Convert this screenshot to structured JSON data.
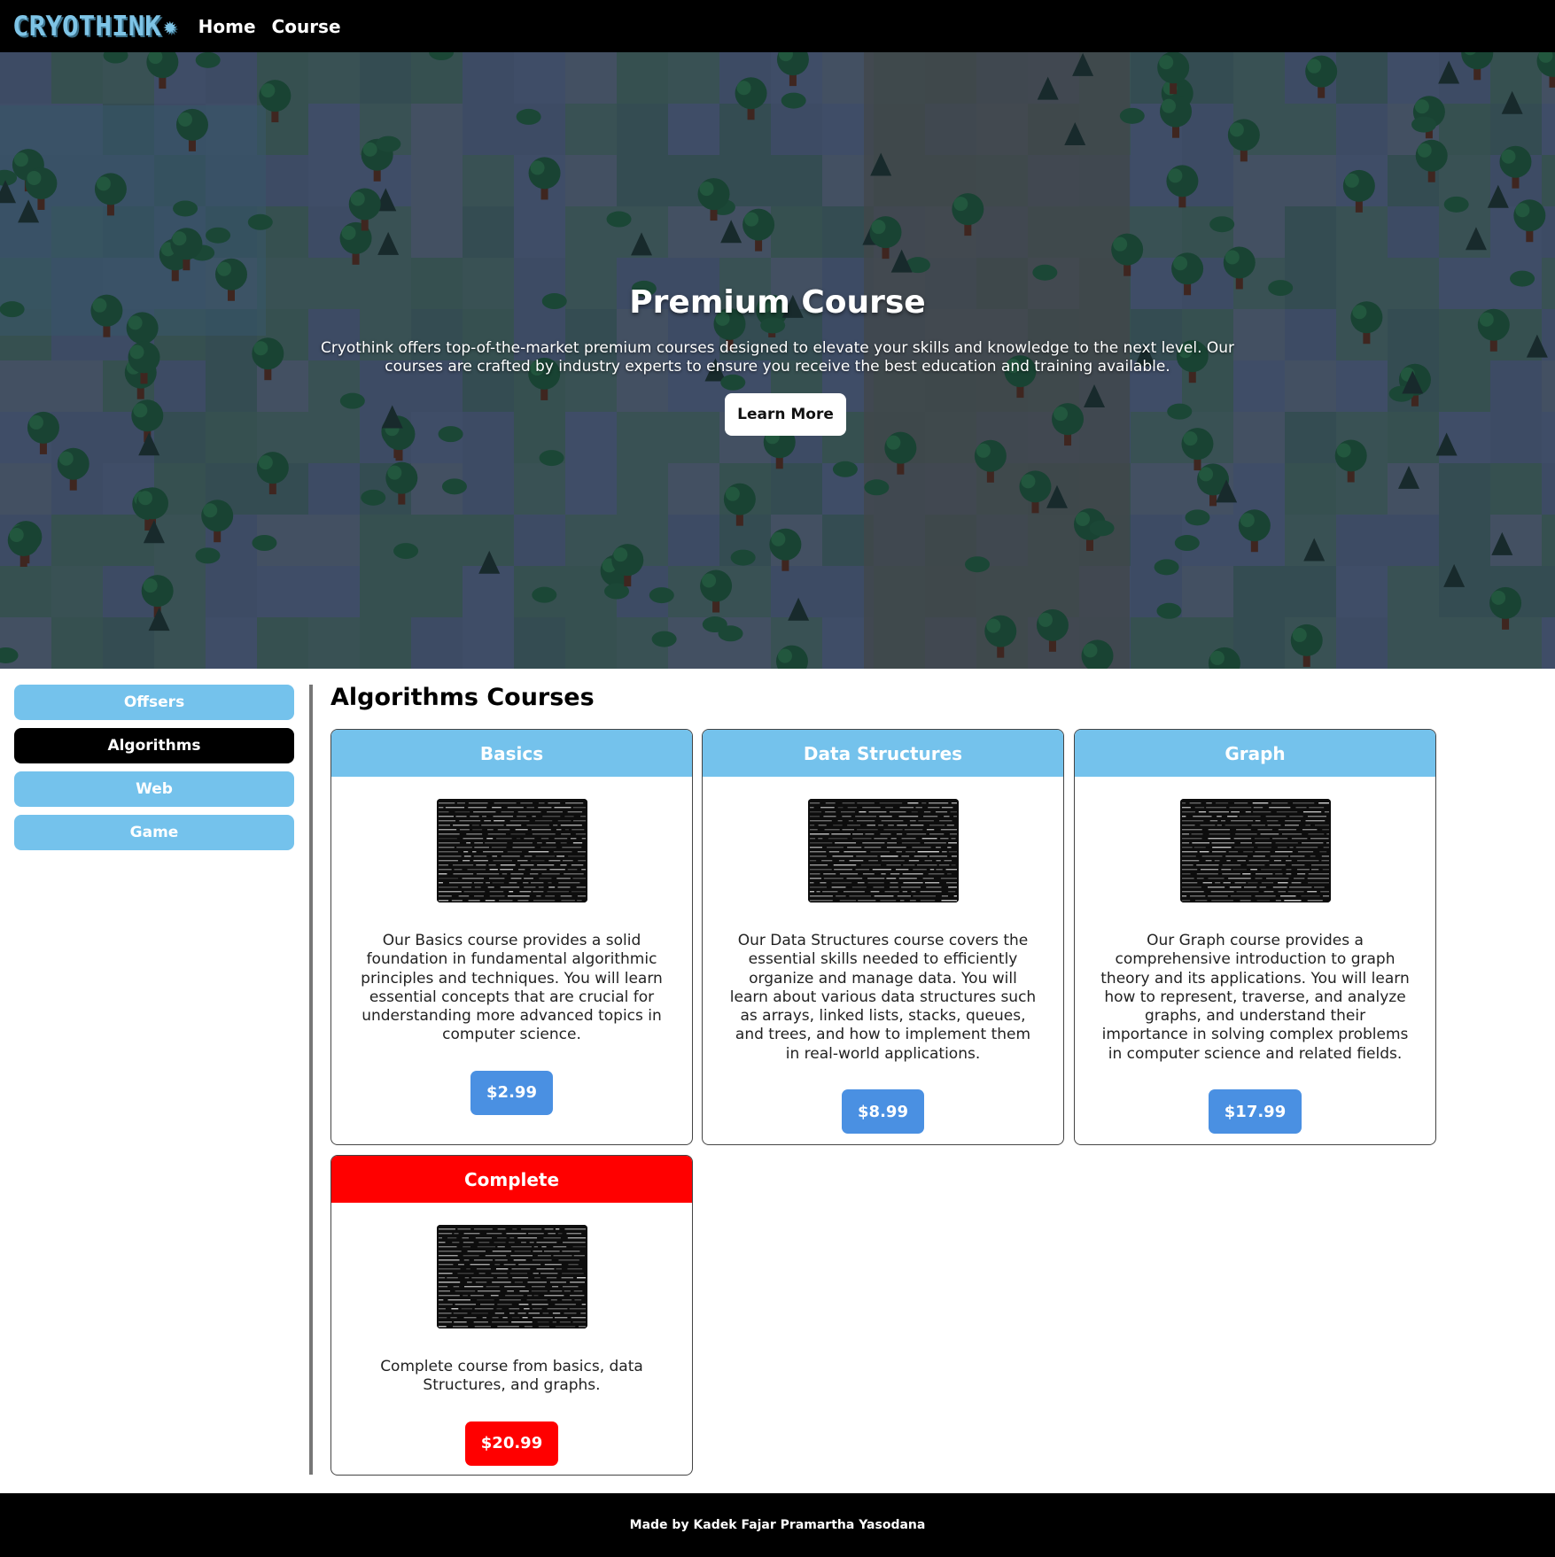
{
  "nav": {
    "logo": "CRYOTHINK",
    "links": [
      "Home",
      "Course"
    ]
  },
  "hero": {
    "title": "Premium Course",
    "description": "Cryothink offers top-of-the-market premium courses designed to elevate your skills and knowledge to the next level. Our courses are crafted by industry experts to ensure you receive the best education and training available.",
    "button": "Learn More"
  },
  "sidebar": {
    "items": [
      {
        "label": "Offsers",
        "active": false
      },
      {
        "label": "Algorithms",
        "active": true
      },
      {
        "label": "Web",
        "active": false
      },
      {
        "label": "Game",
        "active": false
      }
    ]
  },
  "main": {
    "title": "Algorithms Courses",
    "cards": [
      {
        "title": "Basics",
        "description": "Our Basics course provides a solid foundation in fundamental algorithmic principles and techniques. You will learn essential concepts that are crucial for understanding more advanced topics in computer science.",
        "price": "$2.99",
        "color": "#74c2ec"
      },
      {
        "title": "Data Structures",
        "description": "Our Data Structures course covers the essential skills needed to efficiently organize and manage data. You will learn about various data structures such as arrays, linked lists, stacks, queues, and trees, and how to implement them in real-world applications.",
        "price": "$8.99",
        "color": "#74c2ec"
      },
      {
        "title": "Graph",
        "description": "Our Graph course provides a comprehensive introduction to graph theory and its applications. You will learn how to represent, traverse, and analyze graphs, and understand their importance in solving complex problems in computer science and related fields.",
        "price": "$17.99",
        "color": "#74c2ec"
      },
      {
        "title": "Complete",
        "description": "Complete course from basics, data Structures, and graphs.",
        "price": "$20.99",
        "color": "#ff0000"
      }
    ]
  },
  "footer": {
    "text": "Made by Kadek Fajar Pramartha Yasodana"
  },
  "colors": {
    "accent_blue": "#74c2ec",
    "price_blue": "#4a90e2",
    "highlight_red": "#ff0000",
    "navbar_bg": "#000000"
  }
}
